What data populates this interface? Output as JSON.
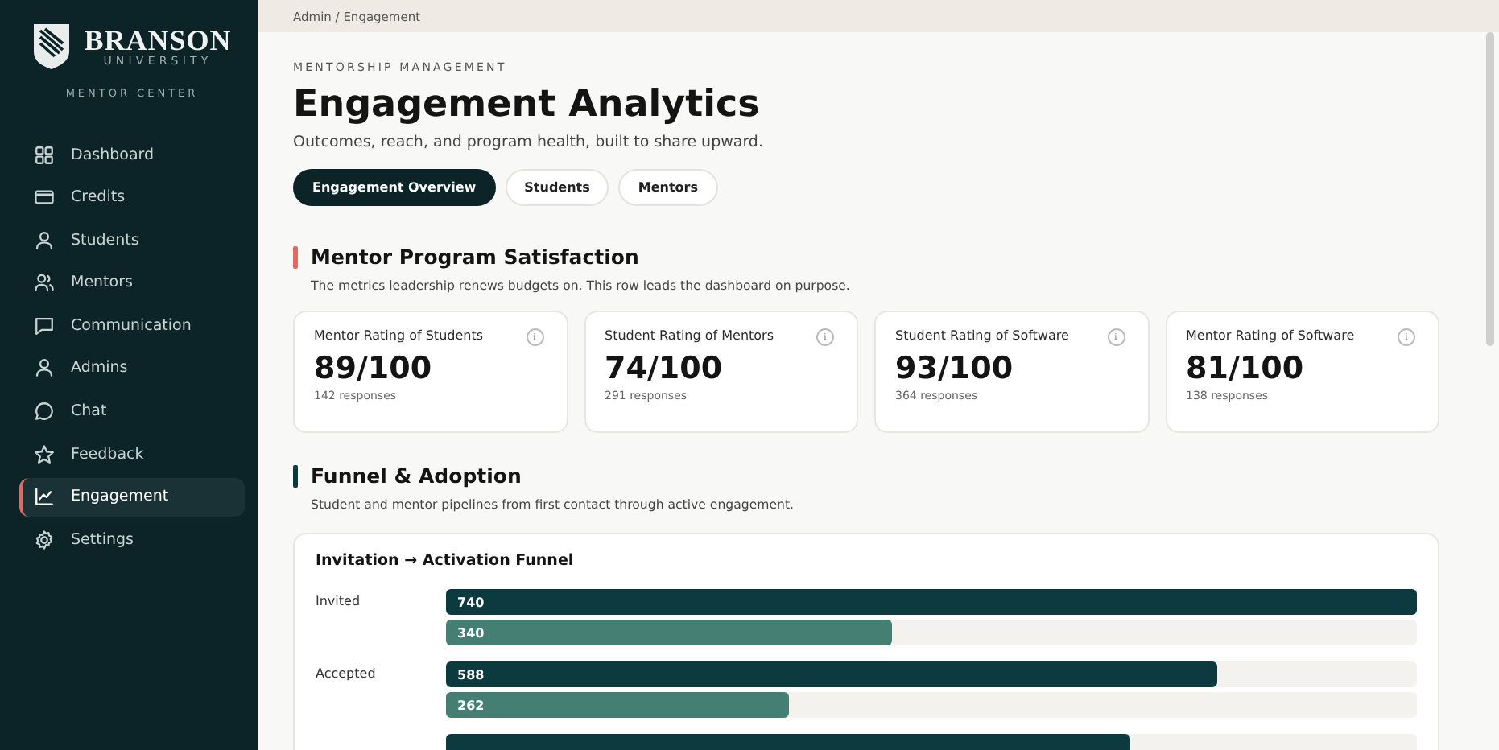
{
  "sidebar": {
    "logo": {
      "name": "BRANSON",
      "subtitle": "UNIVERSITY",
      "tagline": "MENTOR CENTER"
    },
    "items": [
      {
        "label": "Dashboard",
        "selected": false
      },
      {
        "label": "Credits",
        "selected": false
      },
      {
        "label": "Students",
        "selected": false
      },
      {
        "label": "Mentors",
        "selected": false
      },
      {
        "label": "Communication",
        "selected": false
      },
      {
        "label": "Admins",
        "selected": false
      },
      {
        "label": "Chat",
        "selected": false
      },
      {
        "label": "Feedback",
        "selected": false
      },
      {
        "label": "Engagement",
        "selected": true
      },
      {
        "label": "Settings",
        "selected": false
      }
    ]
  },
  "breadcrumb": "Admin / Engagement",
  "header": {
    "eyebrow": "MENTORSHIP MANAGEMENT",
    "title": "Engagement Analytics",
    "subtitle": "Outcomes, reach, and program health, built to share upward."
  },
  "tabs": [
    {
      "label": "Engagement Overview",
      "selected": true
    },
    {
      "label": "Students",
      "selected": false
    },
    {
      "label": "Mentors",
      "selected": false
    }
  ],
  "sections": [
    {
      "title": "Mentor Program Satisfaction",
      "description": "The metrics leadership renews budgets on. This row leads the dashboard on purpose.",
      "color": "#e2695f",
      "metrics": [
        {
          "label": "Mentor Rating of Students",
          "value": "89/100",
          "note": "142 responses",
          "info": "i"
        },
        {
          "label": "Student Rating of Mentors",
          "value": "74/100",
          "note": "291 responses",
          "info": "i"
        },
        {
          "label": "Student Rating of Software",
          "value": "93/100",
          "note": "364 responses",
          "info": "i"
        },
        {
          "label": "Mentor Rating of Software",
          "value": "81/100",
          "note": "138 responses",
          "info": "i"
        }
      ]
    },
    {
      "title": "Funnel & Adoption",
      "description": "Student and mentor pipelines from first contact through active engagement.",
      "color": "#0d3a3e",
      "funnel": {
        "title": "Invitation → Activation Funnel",
        "rows": [
          {
            "label": "Invited",
            "bars": [
              {
                "kind": "primary",
                "value": "740",
                "level": 1.0
              },
              {
                "kind": "secondary",
                "value": "340",
                "level": 0.459
              }
            ]
          },
          {
            "label": "Accepted",
            "bars": [
              {
                "kind": "primary",
                "value": "588",
                "level": 0.795
              },
              {
                "kind": "secondary",
                "value": "262",
                "level": 0.354
              }
            ]
          },
          {
            "bars": [
              {
                "kind": "primary",
                "level": 0.705
              }
            ]
          }
        ]
      }
    }
  ]
}
